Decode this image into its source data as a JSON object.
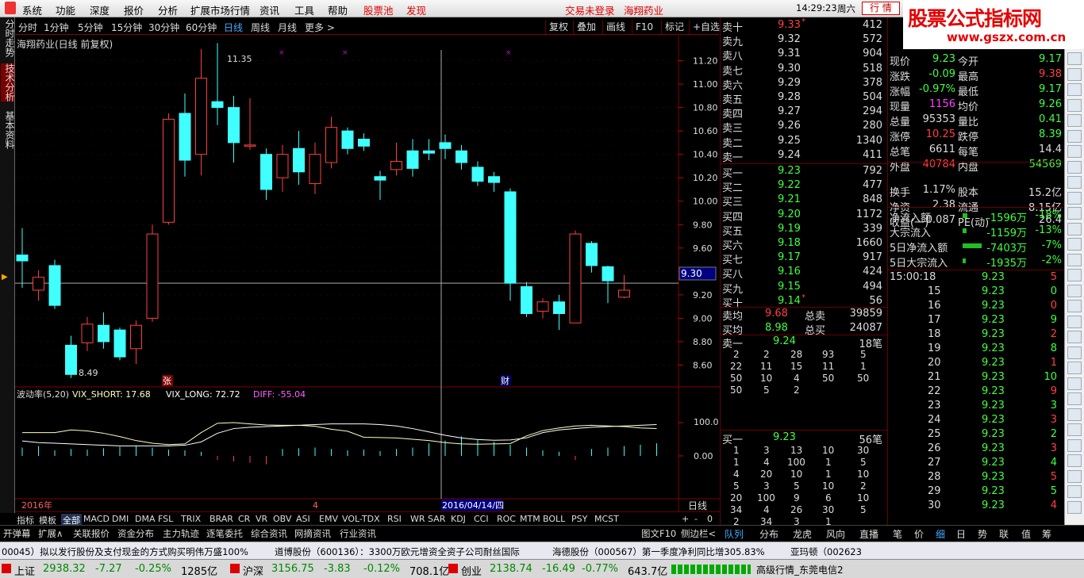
{
  "menu": {
    "items": [
      "系统",
      "功能",
      "深度",
      "报价",
      "分析",
      "扩展市场行情",
      "资讯",
      "工具",
      "帮助"
    ],
    "stock_pool": "股票池",
    "discover": "发现",
    "trade_login": "交易未登录",
    "stock_name": "海翔药业",
    "time": "14:29:23",
    "weekday": "周六",
    "market_button": "行  情",
    "watermark_title": "股票公式指标网",
    "watermark_url": "www.gszx.com.cn"
  },
  "toolbar": {
    "periods": [
      "分时",
      "1分钟",
      "5分钟",
      "15分钟",
      "30分钟",
      "60分钟",
      "日线",
      "周线",
      "月线",
      "更多 >"
    ],
    "selected_period": "日线",
    "buttons": [
      "复权",
      "叠加",
      "画线",
      "F10",
      "标记",
      "+自选"
    ]
  },
  "left_tabs": [
    "分时走势",
    "技术分析",
    "基本资料"
  ],
  "chart": {
    "title": "海翔药业(日线 前复权)",
    "high_label": "11.35",
    "low_label": "8.49",
    "price_ticks": [
      "11.20",
      "11.00",
      "10.80",
      "10.60",
      "10.40",
      "10.20",
      "10.00",
      "9.80",
      "9.60",
      "9.40",
      "9.20",
      "9.00",
      "8.80",
      "8.60"
    ],
    "cursor_price": "9.30",
    "marker_zhang": "张",
    "marker_cai": "财",
    "date_left": "2016年",
    "date_mid": "4",
    "date_cursor": "2016/04/14/四",
    "period_label": "日线",
    "candles": [
      {
        "o": 9.54,
        "c": 9.49,
        "h": 9.77,
        "l": 9.26
      },
      {
        "o": 9.24,
        "c": 9.35,
        "h": 9.41,
        "l": 9.15
      },
      {
        "o": 9.45,
        "c": 9.11,
        "h": 9.5,
        "l": 9.08
      },
      {
        "o": 8.77,
        "c": 8.52,
        "h": 8.85,
        "l": 8.49
      },
      {
        "o": 8.79,
        "c": 8.95,
        "h": 9.01,
        "l": 8.72
      },
      {
        "o": 8.94,
        "c": 8.8,
        "h": 9.05,
        "l": 8.74
      },
      {
        "o": 8.9,
        "c": 8.67,
        "h": 8.92,
        "l": 8.64
      },
      {
        "o": 8.74,
        "c": 8.94,
        "h": 8.98,
        "l": 8.61
      },
      {
        "o": 9.0,
        "c": 9.72,
        "h": 9.8,
        "l": 8.97
      },
      {
        "o": 9.82,
        "c": 10.7,
        "h": 10.75,
        "l": 9.8
      },
      {
        "o": 10.75,
        "c": 10.35,
        "h": 10.92,
        "l": 10.21
      },
      {
        "o": 10.4,
        "c": 11.05,
        "h": 11.3,
        "l": 10.22
      },
      {
        "o": 10.85,
        "c": 10.8,
        "h": 11.35,
        "l": 10.65
      },
      {
        "o": 10.8,
        "c": 10.5,
        "h": 10.9,
        "l": 10.33
      },
      {
        "o": 10.48,
        "c": 10.48,
        "h": 10.88,
        "l": 10.44
      },
      {
        "o": 10.4,
        "c": 10.1,
        "h": 10.45,
        "l": 10.01
      },
      {
        "o": 10.2,
        "c": 10.4,
        "h": 10.48,
        "l": 10.08
      },
      {
        "o": 10.45,
        "c": 10.25,
        "h": 10.6,
        "l": 10.14
      },
      {
        "o": 10.15,
        "c": 10.4,
        "h": 10.5,
        "l": 10.06
      },
      {
        "o": 10.33,
        "c": 10.63,
        "h": 10.72,
        "l": 10.28
      },
      {
        "o": 10.6,
        "c": 10.45,
        "h": 10.63,
        "l": 10.4
      },
      {
        "o": 10.53,
        "c": 10.47,
        "h": 10.58,
        "l": 10.43
      },
      {
        "o": 10.21,
        "c": 10.18,
        "h": 10.26,
        "l": 10.01
      },
      {
        "o": 10.27,
        "c": 10.34,
        "h": 10.5,
        "l": 10.22
      },
      {
        "o": 10.43,
        "c": 10.28,
        "h": 10.53,
        "l": 10.21
      },
      {
        "o": 10.43,
        "c": 10.41,
        "h": 10.53,
        "l": 10.35
      },
      {
        "o": 10.5,
        "c": 10.45,
        "h": 10.57,
        "l": 10.36
      },
      {
        "o": 10.43,
        "c": 10.33,
        "h": 10.48,
        "l": 10.27
      },
      {
        "o": 10.29,
        "c": 10.17,
        "h": 10.34,
        "l": 10.13
      },
      {
        "o": 10.21,
        "c": 10.16,
        "h": 10.25,
        "l": 10.08
      },
      {
        "o": 10.08,
        "c": 9.3,
        "h": 10.11,
        "l": 9.15
      },
      {
        "o": 9.27,
        "c": 9.04,
        "h": 9.31,
        "l": 9.01
      },
      {
        "o": 9.06,
        "c": 9.14,
        "h": 9.17,
        "l": 9.0
      },
      {
        "o": 9.14,
        "c": 9.04,
        "h": 9.2,
        "l": 8.9
      },
      {
        "o": 8.96,
        "c": 9.72,
        "h": 9.75,
        "l": 8.96
      },
      {
        "o": 9.64,
        "c": 9.45,
        "h": 9.66,
        "l": 9.39
      },
      {
        "o": 9.44,
        "c": 9.32,
        "h": 9.45,
        "l": 9.13
      },
      {
        "o": 9.18,
        "c": 9.24,
        "h": 9.37,
        "l": 9.17
      }
    ],
    "indicator": {
      "label": "波动率(5,20)",
      "short": "VIX_SHORT: 17.68",
      "long": "VIX_LONG: 72.72",
      "diff": "DIFF: -55.04",
      "ticks": [
        "100.0",
        "0.00"
      ],
      "short_series": [
        70,
        70,
        70,
        78,
        75,
        68,
        58,
        46,
        38,
        34,
        36,
        70,
        98,
        100,
        96,
        93,
        92,
        92,
        89,
        80,
        74,
        56,
        55,
        54,
        50,
        46,
        40,
        36,
        35,
        36,
        37,
        60,
        76,
        84,
        90,
        92,
        90,
        88,
        84,
        82
      ],
      "long_series": [
        45,
        40,
        38,
        36,
        34,
        32,
        30,
        30,
        30,
        30,
        32,
        42,
        68,
        82,
        86,
        88,
        90,
        92,
        94,
        96,
        96,
        96,
        94,
        90,
        82,
        72,
        62,
        54,
        49,
        47,
        48,
        54,
        70,
        78,
        82,
        86,
        88,
        90,
        92,
        94
      ],
      "bars": [
        -12,
        -14,
        -8,
        -10,
        -9,
        -11,
        -13,
        -15,
        -12,
        -9,
        -8,
        -6,
        6,
        8,
        10,
        12,
        -10,
        -11,
        -12,
        -10,
        -8,
        -9,
        -7,
        -10,
        -12,
        -18,
        -22,
        -28,
        -24,
        -20,
        -16,
        -12,
        -8,
        -6,
        6,
        -10,
        -12,
        -14,
        -16,
        -18
      ]
    }
  },
  "indicator_tabs": [
    "指标",
    "模板",
    "全部",
    "MACD",
    "DMI",
    "DMA",
    "FSL",
    "TRIX",
    "BRAR",
    "CR",
    "VR",
    "OBV",
    "ASI",
    "EMV",
    "VOL-TDX",
    "RSI",
    "WR",
    "SAR",
    "KDJ",
    "CCI",
    "ROC",
    "MTM",
    "BOLL",
    "PSY",
    "MCST"
  ],
  "chart_controls": [
    "+",
    "-",
    "0"
  ],
  "panel_tabs": [
    "开弹幕",
    "扩展∧",
    "关联报价",
    "资金分布",
    "主力轨迹",
    "逐笔委托",
    "综合资讯",
    "网摘资讯",
    "行业资讯"
  ],
  "right_controls": [
    "图文F10",
    "侧边栏<"
  ],
  "right_tabs": [
    "队列",
    "分布",
    "龙虎",
    "风向",
    "直播",
    "笔",
    "价",
    "细",
    "日",
    "势",
    "联",
    "值",
    "筹"
  ],
  "orderbook": {
    "sell": [
      {
        "label": "卖十",
        "price": "9.33",
        "flag": "*",
        "vol": "412"
      },
      {
        "label": "卖九",
        "price": "9.32",
        "flag": "",
        "vol": "572"
      },
      {
        "label": "卖八",
        "price": "9.31",
        "flag": "",
        "vol": "904"
      },
      {
        "label": "卖七",
        "price": "9.30",
        "flag": "",
        "vol": "518"
      },
      {
        "label": "卖六",
        "price": "9.29",
        "flag": "",
        "vol": "378"
      },
      {
        "label": "卖五",
        "price": "9.28",
        "flag": "",
        "vol": "504"
      },
      {
        "label": "卖四",
        "price": "9.27",
        "flag": "",
        "vol": "294"
      },
      {
        "label": "卖三",
        "price": "9.26",
        "flag": "",
        "vol": "280"
      },
      {
        "label": "卖二",
        "price": "9.25",
        "flag": "",
        "vol": "1340"
      },
      {
        "label": "卖一",
        "price": "9.24",
        "flag": "",
        "vol": "411"
      }
    ],
    "buy": [
      {
        "label": "买一",
        "price": "9.23",
        "flag": "",
        "vol": "792"
      },
      {
        "label": "买二",
        "price": "9.22",
        "flag": "",
        "vol": "477"
      },
      {
        "label": "买三",
        "price": "9.21",
        "flag": "",
        "vol": "848"
      },
      {
        "label": "买四",
        "price": "9.20",
        "flag": "",
        "vol": "1172"
      },
      {
        "label": "买五",
        "price": "9.19",
        "flag": "",
        "vol": "339"
      },
      {
        "label": "买六",
        "price": "9.18",
        "flag": "",
        "vol": "1660"
      },
      {
        "label": "买七",
        "price": "9.17",
        "flag": "",
        "vol": "917"
      },
      {
        "label": "买八",
        "price": "9.16",
        "flag": "",
        "vol": "424"
      },
      {
        "label": "买九",
        "price": "9.15",
        "flag": "",
        "vol": "494"
      },
      {
        "label": "买十",
        "price": "9.14",
        "flag": "*",
        "vol": "56"
      }
    ],
    "avg_sell": {
      "label": "卖均",
      "price": "9.68",
      "tlabel": "总卖",
      "total": "39859"
    },
    "avg_buy": {
      "label": "买均",
      "price": "8.98",
      "tlabel": "总买",
      "total": "24087"
    },
    "ask1": {
      "label": "卖一",
      "price": "9.24",
      "count": "18笔",
      "rows": [
        [
          "2",
          "2",
          "28",
          "93",
          "5"
        ],
        [
          "22",
          "11",
          "15",
          "11",
          "1"
        ],
        [
          "50",
          "10",
          "4",
          "50",
          "50"
        ],
        [
          "50",
          "5",
          "2",
          "",
          ""
        ]
      ]
    },
    "bid1": {
      "label": "买一",
      "price": "9.23",
      "count": "56笔",
      "rows": [
        [
          "1",
          "3",
          "13",
          "10",
          "30"
        ],
        [
          "1",
          "4",
          "100",
          "1",
          "5"
        ],
        [
          "4",
          "20",
          "10",
          "1",
          "10"
        ],
        [
          "5",
          "3",
          "5",
          "10",
          "2"
        ],
        [
          "20",
          "100",
          "9",
          "6",
          "10"
        ],
        [
          "34",
          "4",
          "26",
          "30",
          "5"
        ],
        [
          "2",
          "34",
          "3",
          "1",
          ""
        ]
      ]
    }
  },
  "quote": {
    "rows": [
      [
        {
          "l": "现价",
          "v": "9.23",
          "c": "g"
        },
        {
          "l": "今开",
          "v": "9.17",
          "c": "g"
        }
      ],
      [
        {
          "l": "涨跌",
          "v": "-0.09",
          "c": "g"
        },
        {
          "l": "最高",
          "v": "9.38",
          "c": "r"
        }
      ],
      [
        {
          "l": "涨幅",
          "v": "-0.97%",
          "c": "g"
        },
        {
          "l": "最低",
          "v": "9.17",
          "c": "g"
        }
      ],
      [
        {
          "l": "现量",
          "v": "1156",
          "c": "p"
        },
        {
          "l": "均价",
          "v": "9.26",
          "c": "g"
        }
      ],
      [
        {
          "l": "总量",
          "v": "95353",
          "c": "w"
        },
        {
          "l": "量比",
          "v": "0.41",
          "c": "g"
        }
      ],
      [
        {
          "l": "涨停",
          "v": "10.25",
          "c": "r"
        },
        {
          "l": "跌停",
          "v": "8.39",
          "c": "g"
        }
      ],
      [
        {
          "l": "总笔",
          "v": "6611",
          "c": "w"
        },
        {
          "l": "每笔",
          "v": "14.4",
          "c": "w"
        }
      ],
      [
        {
          "l": "外盘",
          "v": "40784",
          "c": "r"
        },
        {
          "l": "内盘",
          "v": "54569",
          "c": "g"
        }
      ],
      [
        {
          "l": "换手",
          "v": "1.17%",
          "c": "w"
        },
        {
          "l": "股本",
          "v": "15.2亿",
          "c": "w"
        }
      ],
      [
        {
          "l": "净资",
          "v": "2.38",
          "c": "w"
        },
        {
          "l": "流通",
          "v": "8.15亿",
          "c": "w"
        }
      ],
      [
        {
          "l": "收益(一)",
          "v": "0.087",
          "c": "w"
        },
        {
          "l": "PE(动)",
          "v": "26.4",
          "c": "w"
        }
      ]
    ],
    "flows": [
      {
        "l": "净流入额",
        "v": "-1596万",
        "p": "-18%",
        "bar": 6
      },
      {
        "l": "大宗流入",
        "v": "-1159万",
        "p": "-13%",
        "bar": 5
      },
      {
        "l": "5日净流入额",
        "v": "-7403万",
        "p": "-7%",
        "bar": 24
      },
      {
        "l": "5日大宗流入",
        "v": "-1935万",
        "p": "-2%",
        "bar": 4
      }
    ],
    "ticks": [
      [
        "15:00:18",
        "9.23",
        "5"
      ],
      [
        "15",
        "9.23",
        "0"
      ],
      [
        "16",
        "9.23",
        "0"
      ],
      [
        "17",
        "9.23",
        "9"
      ],
      [
        "18",
        "9.23",
        "2"
      ],
      [
        "19",
        "9.23",
        "8"
      ],
      [
        "20",
        "9.23",
        "1"
      ],
      [
        "21",
        "9.23",
        "10"
      ],
      [
        "22",
        "9.23",
        "9"
      ],
      [
        "23",
        "9.23",
        "3"
      ],
      [
        "24",
        "9.23",
        "3"
      ],
      [
        "25",
        "9.23",
        "2"
      ],
      [
        "26",
        "9.23",
        "3"
      ],
      [
        "27",
        "9.23",
        "4"
      ],
      [
        "28",
        "9.23",
        "5"
      ],
      [
        "29",
        "9.23",
        "5"
      ],
      [
        "30",
        "9.23",
        "4"
      ]
    ]
  },
  "ticker": [
    "00045）拟以发行股份及支付现金的方式购买明伟万盛100%",
    "道博股份（600136）：3300万欧元增资全资子公司耐丝国际",
    "海德股份（000567）第一季度净利同比增305.83%",
    "亚玛顿（002623"
  ],
  "status": [
    {
      "l": "上证",
      "v": "2938.32",
      "d": "-7.27",
      "p": "-0.25%",
      "a": "1285亿"
    },
    {
      "l": "沪深",
      "v": "3156.75",
      "d": "-3.83",
      "p": "-0.12%",
      "a": "708.1亿"
    },
    {
      "l": "创业",
      "v": "2138.74",
      "d": "-16.49",
      "p": "-0.77%",
      "a": "643.7亿"
    }
  ],
  "status_server": "高级行情_东莞电信2",
  "colors": {
    "up": "#ff4040",
    "down": "#40ffff",
    "grid": "#800000",
    "vix_short": "#ffffc0",
    "vix_long": "#ffffff"
  }
}
